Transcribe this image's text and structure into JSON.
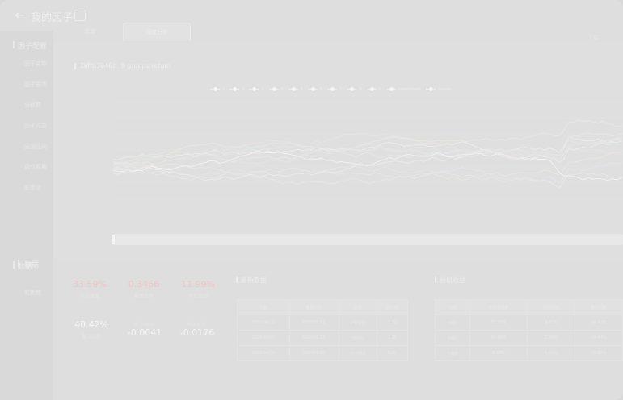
{
  "header": {
    "back_icon": "arrow-left-icon",
    "title": "我的因子",
    "edit_icon": "edit-icon"
  },
  "tabs": [
    {
      "label": "总览"
    },
    {
      "label": "深度分析"
    }
  ],
  "export_label": "下载",
  "sidebar": {
    "section1": "因子配置",
    "items": [
      "因子名称",
      "因子描述",
      "分组数",
      "因子方向",
      "回测区间",
      "调仓周期",
      "股票池"
    ],
    "section2": "数据",
    "sub": "的指数"
  },
  "chart": {
    "title": "Diffb3646b: 9 groups return",
    "legend": [
      "1",
      "2",
      "3",
      "4",
      "5",
      "6",
      "7",
      "8",
      "9",
      "benchmark",
      "excess"
    ]
  },
  "chart_data": {
    "type": "line",
    "title": "Diffb3646b: 9 groups return",
    "series_count": 11
  },
  "metrics": [
    {
      "value": "33.59%",
      "label": "年化收益",
      "color": "#f3c7c7"
    },
    {
      "value": "0.3466",
      "label": "夏普比率",
      "color": "#f3c7c7"
    },
    {
      "value": "11.99%",
      "label": "年化波动",
      "color": "#f3c7c7"
    },
    {
      "value": "40.42%",
      "label": "最大回撤",
      "color": "#ffffff"
    },
    {
      "value": "-0.0041",
      "label": "IC_mean",
      "color": "#ffffff"
    },
    {
      "value": "-0.0176",
      "label": "Rank_IC",
      "color": "#ffffff"
    }
  ],
  "latest": {
    "title": "最新数据",
    "headers": [
      "日期",
      "股票代码",
      "名称",
      "因子值"
    ],
    "rows": [
      [
        "2023-04-03",
        "000001.SZ",
        "平安银行",
        "1.72"
      ],
      [
        "2023-04-03",
        "000002.SZ",
        "万科A",
        "1.35"
      ],
      [
        "2023-04-03",
        "000063.SZ",
        "中兴通讯",
        "0.91"
      ]
    ]
  },
  "groups": {
    "title": "分组收益",
    "headers": [
      "分组",
      "年化收益率",
      "超额收益",
      "最大回撤"
    ],
    "rows": [
      [
        "分组1",
        "11.59%",
        "3.42%",
        "40.42%"
      ],
      [
        "分组2",
        "10.96%",
        "2.28%",
        "40.44%"
      ],
      [
        "分组3",
        "9.53%",
        "1.64%",
        "39.88%"
      ]
    ]
  }
}
